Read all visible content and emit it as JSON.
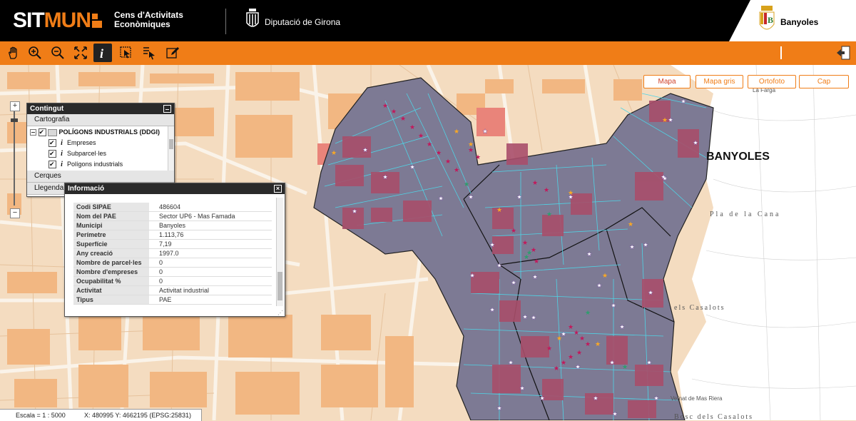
{
  "header": {
    "logo_a": "SIT",
    "logo_b": "MUN",
    "app_title_line1": "Cens d'Activitats",
    "app_title_line2": "Econòmiques",
    "org_name": "Diputació de Girona",
    "town_name": "Banyoles",
    "town_shield_icon": "banyoles-shield-icon",
    "org_icon": "diputacio-girona-icon"
  },
  "toolbar": {
    "tools": [
      {
        "name": "pan",
        "icon": "hand-icon"
      },
      {
        "name": "zoom-in",
        "icon": "zoom-in-icon"
      },
      {
        "name": "zoom-out",
        "icon": "zoom-out-icon"
      },
      {
        "name": "full-extent",
        "icon": "expand-icon"
      },
      {
        "name": "info",
        "icon": "info-icon",
        "active": true
      },
      {
        "name": "select",
        "icon": "select-icon"
      },
      {
        "name": "select-list",
        "icon": "list-select-icon"
      },
      {
        "name": "edit",
        "icon": "pencil-icon"
      }
    ],
    "exit_icon": "exit-icon"
  },
  "basemaps": [
    {
      "label": "Mapa",
      "active": true
    },
    {
      "label": "Mapa gris",
      "active": false
    },
    {
      "label": "Ortofoto",
      "active": false
    },
    {
      "label": "Cap",
      "active": false
    }
  ],
  "toc": {
    "title": "Contingut",
    "section_cartografia": "Cartografia",
    "tree": [
      {
        "label": "POLÍGONS INDUSTRIALS (DDGI)",
        "group": true
      },
      {
        "label": "Empreses"
      },
      {
        "label": "Subparcel·les"
      },
      {
        "label": "Polígons industrials"
      }
    ],
    "section_cerques": "Cerques",
    "section_llegenda": "Llegenda"
  },
  "info": {
    "title": "Informació",
    "rows": [
      {
        "k": "Codi SIPAE",
        "v": "486604"
      },
      {
        "k": "Nom del PAE",
        "v": "Sector UP6 - Mas Famada"
      },
      {
        "k": "Municipi",
        "v": "Banyoles"
      },
      {
        "k": "Perímetre",
        "v": "1.113,76"
      },
      {
        "k": "Superfície",
        "v": "7,19"
      },
      {
        "k": "Any creació",
        "v": "1997.0"
      },
      {
        "k": "Nombre de parcel·les",
        "v": "0"
      },
      {
        "k": "Nombre d'empreses",
        "v": "0"
      },
      {
        "k": "Ocupabilitat %",
        "v": "0"
      },
      {
        "k": "Activitat",
        "v": "Activitat industrial"
      },
      {
        "k": "Tipus",
        "v": "PAE"
      }
    ]
  },
  "status": {
    "scale": "Escala = 1 : 5000",
    "coords": "X: 480995 Y: 4662195 (EPSG:25831)"
  },
  "map_labels": {
    "town": "BANYOLES",
    "area_1": "Pla de la Cana",
    "area_2": "els Casalots",
    "area_3": "Bosc dels Casalots",
    "area_4": "La Farga",
    "area_5": "Veïnat de Mas Riera"
  },
  "colors": {
    "brand_orange": "#f07d17",
    "polygon_fill": "#7d7a94",
    "building_fill": "#a84e6a",
    "parcel_line": "#4fd4e6"
  }
}
